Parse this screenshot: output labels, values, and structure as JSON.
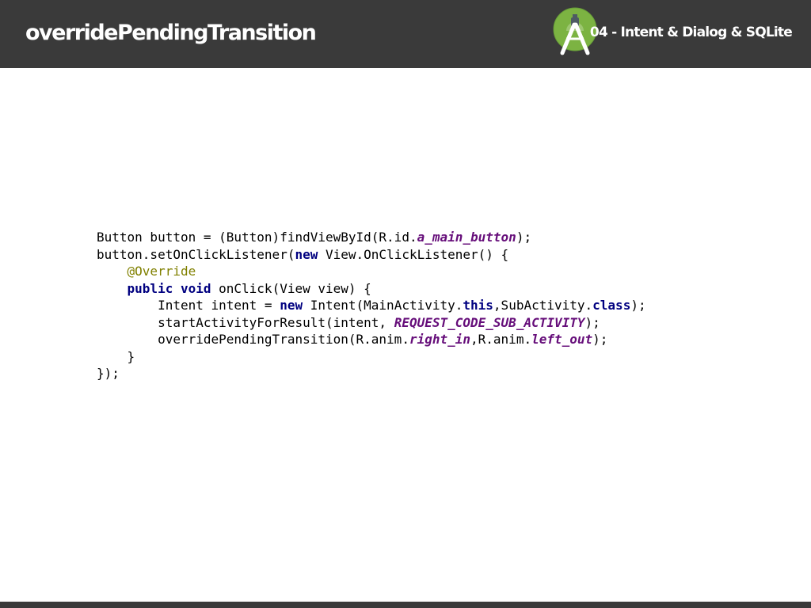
{
  "header": {
    "title": "overridePendingTransition",
    "subtitle": "04 - Intent & Dialog & SQLite",
    "logo_icon": "android-studio-icon"
  },
  "colors": {
    "header_bg": "#3a3a3a",
    "keyword": "#000080",
    "annotation": "#808000",
    "field": "#660e7a"
  },
  "code": {
    "line1": {
      "a": "Button button = (Button)findViewById(R.id.",
      "field": "a_main_button",
      "b": ");"
    },
    "line2": {
      "a": "button.setOnClickListener(",
      "kw": "new",
      "b": " View.OnClickListener() {"
    },
    "line3": {
      "indent": "    ",
      "annotation": "@Override"
    },
    "line4": {
      "indent": "    ",
      "kw1": "public",
      "sp": " ",
      "kw2": "void",
      "b": " onClick(View view) {"
    },
    "line5": {
      "a": "        Intent intent = ",
      "kw1": "new",
      "b": " Intent(MainActivity.",
      "kw2": "this",
      "c": ",SubActivity.",
      "kw3": "class",
      "d": ");"
    },
    "line6": {
      "a": "        startActivityForResult(intent, ",
      "field": "REQUEST_CODE_SUB_ACTIVITY",
      "b": ");"
    },
    "line7": {
      "a": "        overridePendingTransition(R.anim.",
      "field1": "right_in",
      "b": ",R.anim.",
      "field2": "left_out",
      "c": ");"
    },
    "line8": {
      "a": "    }"
    },
    "line9": {
      "a": "});"
    }
  }
}
